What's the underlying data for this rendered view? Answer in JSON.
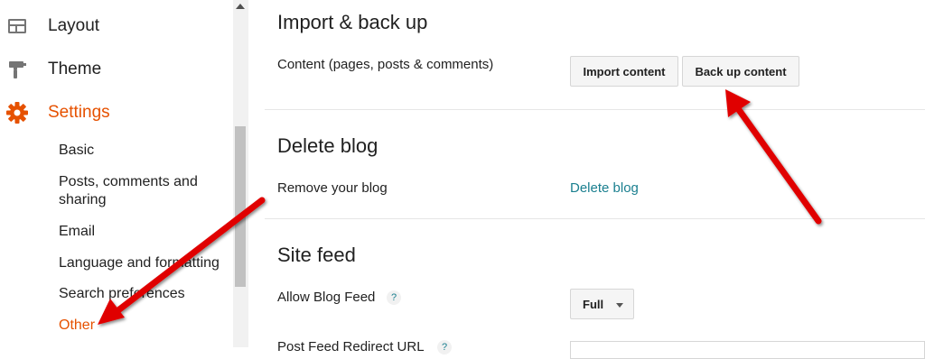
{
  "sidebar": {
    "layout": {
      "label": "Layout",
      "icon": "layout-icon"
    },
    "theme": {
      "label": "Theme",
      "icon": "paint-roller-icon"
    },
    "settings": {
      "label": "Settings",
      "icon": "gear-icon"
    },
    "sub_items": [
      {
        "label": "Basic"
      },
      {
        "label": "Posts, comments and sharing"
      },
      {
        "label": "Email"
      },
      {
        "label": "Language and formatting"
      },
      {
        "label": "Search preferences"
      },
      {
        "label": "Other"
      }
    ]
  },
  "main": {
    "import_backup": {
      "title": "Import & back up",
      "content_label": "Content (pages, posts & comments)",
      "import_button": "Import content",
      "backup_button": "Back up content"
    },
    "delete_blog": {
      "title": "Delete blog",
      "remove_label": "Remove your blog",
      "delete_link": "Delete blog"
    },
    "site_feed": {
      "title": "Site feed",
      "allow_feed_label": "Allow Blog Feed",
      "help_glyph": "?",
      "allow_feed_value": "Full",
      "post_feed_redirect_label": "Post Feed Redirect URL"
    }
  },
  "colors": {
    "accent": "#e65100",
    "link": "#1a7f8f",
    "annotation_arrow": "#e00000"
  }
}
